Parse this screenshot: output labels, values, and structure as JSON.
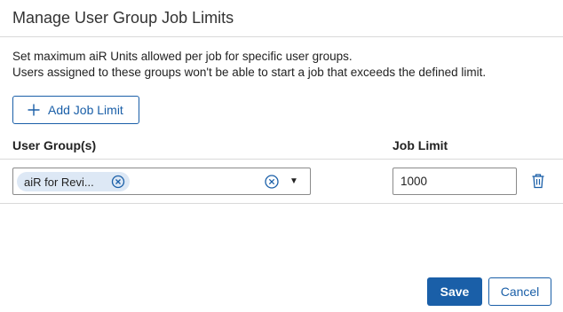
{
  "dialog": {
    "title": "Manage User Group Job Limits",
    "description_line1": "Set maximum aiR Units allowed per job for specific user groups.",
    "description_line2": "Users assigned to these groups won't be able to start a job that exceeds the defined limit."
  },
  "toolbar": {
    "add_label": "Add Job Limit"
  },
  "columns": {
    "user_groups": "User Group(s)",
    "job_limit": "Job Limit"
  },
  "rows": [
    {
      "groups": [
        "aiR for Revi..."
      ],
      "job_limit": "1000"
    }
  ],
  "footer": {
    "save_label": "Save",
    "cancel_label": "Cancel"
  },
  "colors": {
    "accent": "#1a5fa8",
    "chip_bg": "#dde8f5",
    "border": "#d9d9d9"
  },
  "icons": {
    "add": "plus-icon",
    "chip_remove": "circle-x-icon",
    "clear": "circle-x-icon",
    "dropdown": "caret-down-icon",
    "delete": "trash-icon"
  }
}
